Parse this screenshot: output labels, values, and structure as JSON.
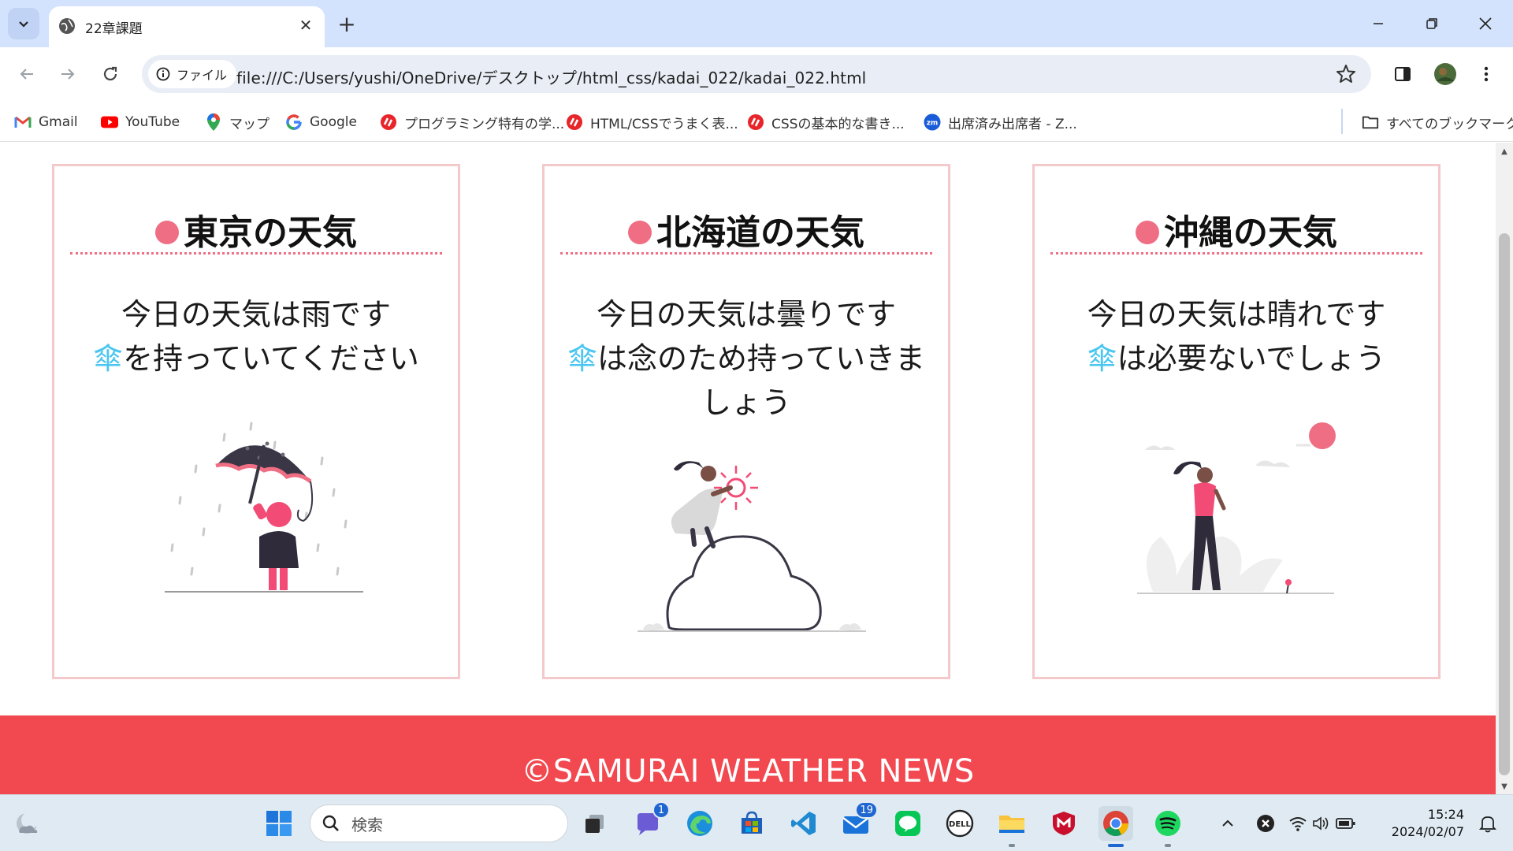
{
  "browser": {
    "tab_title": "22章課題",
    "file_chip_label": "ファイル",
    "url": "file:///C:/Users/yushi/OneDrive/デスクトップ/html_css/kadai_022/kadai_022.html"
  },
  "bookmarks": [
    {
      "label": "Gmail",
      "icon": "gmail-icon"
    },
    {
      "label": "YouTube",
      "icon": "youtube-icon"
    },
    {
      "label": "マップ",
      "icon": "maps-icon"
    },
    {
      "label": "Google",
      "icon": "google-icon"
    },
    {
      "label": "プログラミング特有の学...",
      "icon": "samurai-icon"
    },
    {
      "label": "HTML/CSSでうまく表...",
      "icon": "samurai-icon"
    },
    {
      "label": "CSSの基本的な書き...",
      "icon": "samurai-icon"
    },
    {
      "label": "出席済み出席者 - Z...",
      "icon": "zoom-icon"
    }
  ],
  "bookmarks_folder": "すべてのブックマーク",
  "cards": [
    {
      "title": "東京の天気",
      "line1": "今日の天気は雨です",
      "umbrella": "傘",
      "line2": "を持っていてください",
      "line3": ""
    },
    {
      "title": "北海道の天気",
      "line1": "今日の天気は曇りです",
      "umbrella": "傘",
      "line2": "は念のため持っていきま",
      "line3": "しょう"
    },
    {
      "title": "沖縄の天気",
      "line1": "今日の天気は晴れです",
      "umbrella": "傘",
      "line2": "は必要ないでしょう",
      "line3": ""
    }
  ],
  "footer": {
    "copyright": "©SAMURAI WEATHER NEWS"
  },
  "taskbar": {
    "search_placeholder": "検索",
    "teams_badge": "1",
    "mail_badge": "19",
    "time": "15:24",
    "date": "2024/02/07"
  },
  "colors": {
    "accent_pink": "#ef6e84",
    "card_border": "#f3c9cc",
    "footer_red": "#f2484f",
    "umbrella_blue": "#4bc6f0"
  }
}
